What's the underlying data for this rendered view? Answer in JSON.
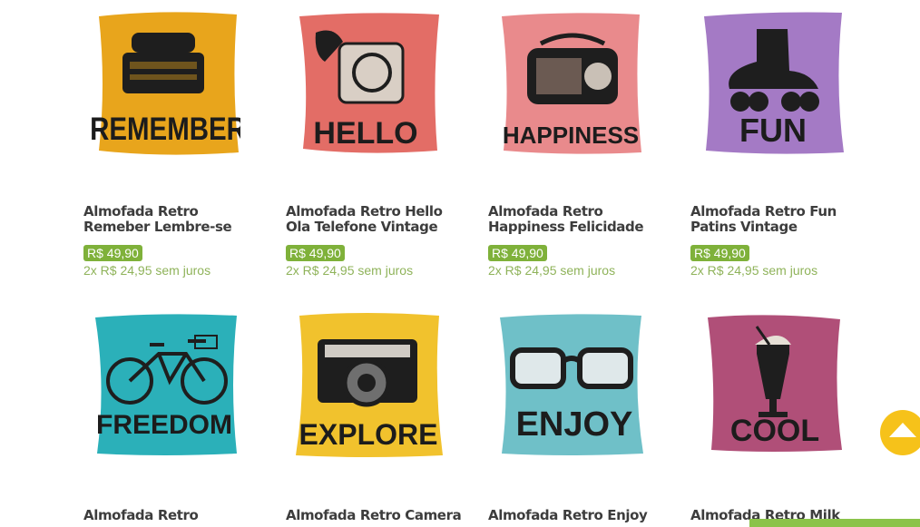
{
  "colors": {
    "price_badge": "#7fb13a",
    "installments": "#8fb35a",
    "title": "#3d3d3d",
    "scroll_button": "#f6c21a",
    "bottom_strip": "#8bc34a"
  },
  "products": [
    {
      "title_line1": "Almofada Retro",
      "title_line2": "Remeber Lembre-se",
      "price": "R$ 49,90",
      "installments": "2x R$ 24,95 sem juros",
      "pillow_text": "REMEMBER",
      "pillow_color": "#e8a51c",
      "icon": "typewriter-icon"
    },
    {
      "title_line1": "Almofada Retro Hello",
      "title_line2": "Ola Telefone Vintage",
      "price": "R$ 49,90",
      "installments": "2x R$ 24,95 sem juros",
      "pillow_text": "HELLO",
      "pillow_color": "#e36d66",
      "icon": "telephone-icon"
    },
    {
      "title_line1": "Almofada Retro",
      "title_line2": "Happiness Felicidade",
      "price": "R$ 49,90",
      "installments": "2x R$ 24,95 sem juros",
      "pillow_text": "HAPPINESS",
      "pillow_color": "#e98a8c",
      "icon": "radio-icon"
    },
    {
      "title_line1": "Almofada Retro Fun",
      "title_line2": "Patins Vintage",
      "price": "R$ 49,90",
      "installments": "2x R$ 24,95 sem juros",
      "pillow_text": "FUN",
      "pillow_color": "#a47ac5",
      "icon": "roller-skate-icon"
    },
    {
      "title_line1": "Almofada Retro",
      "title_line2": "",
      "price": "",
      "installments": "",
      "pillow_text": "FREEDOM",
      "pillow_color": "#2bb0b9",
      "icon": "bicycle-icon"
    },
    {
      "title_line1": "Almofada Retro Camera",
      "title_line2": "",
      "price": "",
      "installments": "",
      "pillow_text": "EXPLORE",
      "pillow_color": "#f1c22d",
      "icon": "camera-icon"
    },
    {
      "title_line1": "Almofada Retro Enjoy",
      "title_line2": "",
      "price": "",
      "installments": "",
      "pillow_text": "ENJOY",
      "pillow_color": "#6fc0c8",
      "icon": "glasses-icon"
    },
    {
      "title_line1": "Almofada Retro Milk",
      "title_line2": "",
      "price": "",
      "installments": "",
      "pillow_text": "COOL",
      "pillow_color": "#b04f78",
      "icon": "milkshake-icon"
    }
  ],
  "scroll_top": {
    "icon": "arrow-up-icon"
  }
}
